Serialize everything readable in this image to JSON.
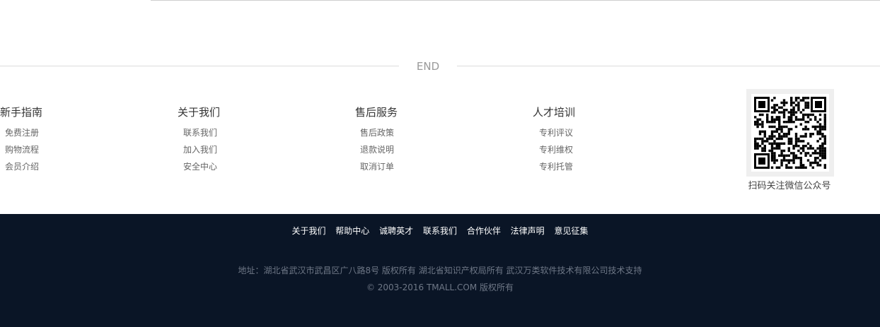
{
  "end_divider": {
    "label": "END"
  },
  "columns": [
    {
      "title": "新手指南",
      "items": [
        "免费注册",
        "购物流程",
        "会员介绍"
      ]
    },
    {
      "title": "关于我们",
      "items": [
        "联系我们",
        "加入我们",
        "安全中心"
      ]
    },
    {
      "title": "售后服务",
      "items": [
        "售后政策",
        "退款说明",
        "取消订单"
      ]
    },
    {
      "title": "人才培训",
      "items": [
        "专利评议",
        "专利维权",
        "专利托管"
      ]
    }
  ],
  "qr": {
    "caption": "扫码关注微信公众号",
    "icon": "qr-code-icon"
  },
  "footer": {
    "links": [
      "关于我们",
      "帮助中心",
      "诚聘英才",
      "联系我们",
      "合作伙伴",
      "法律声明",
      "意见征集"
    ],
    "address": "地址：湖北省武汉市武昌区广八路8号 版权所有 湖北省知识产权局所有 武汉万类软件技术有限公司技术支持",
    "copyright": "© 2003-2016 TMALL.COM 版权所有"
  },
  "colors": {
    "footer_bg": "#0a1526",
    "divider": "#dcdcdc"
  }
}
